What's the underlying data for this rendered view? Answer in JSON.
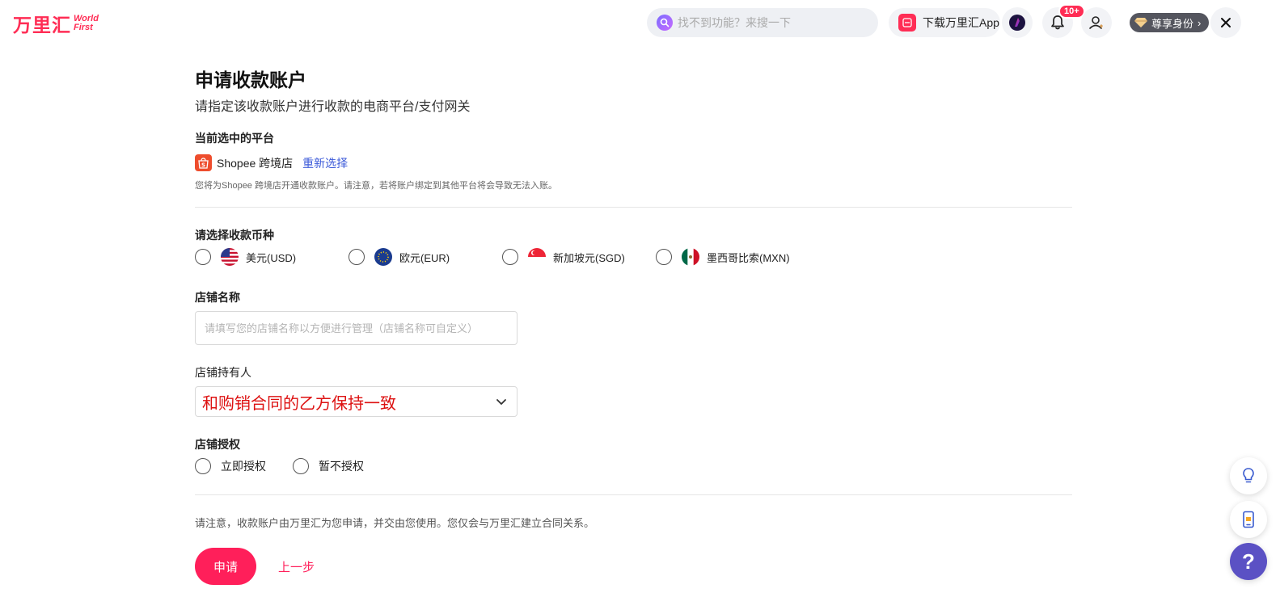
{
  "header": {
    "logo_cn": "万里汇",
    "logo_en_line1": "World",
    "logo_en_line2": "First",
    "search_placeholder": "找不到功能？来搜一下",
    "download_app_label": "下载万里汇App",
    "app_icon_text": "WorldFirst",
    "notification_count": "10+",
    "vip_label": "尊享身份",
    "vip_chevron": "›"
  },
  "page": {
    "title": "申请收款账户",
    "subtitle": "请指定该收款账户进行收款的电商平台/支付网关"
  },
  "platform": {
    "section_title": "当前选中的平台",
    "name": "Shopee 跨境店",
    "reselect_label": "重新选择",
    "note": "您将为Shopee 跨境店开通收款账户。请注意，若将账户绑定到其他平台将会导致无法入账。"
  },
  "currency": {
    "section_title": "请选择收款币种",
    "options": [
      {
        "label": "美元(USD)",
        "flag": "us-flag-icon"
      },
      {
        "label": "欧元(EUR)",
        "flag": "eu-flag-icon"
      },
      {
        "label": "新加坡元(SGD)",
        "flag": "sg-flag-icon"
      },
      {
        "label": "墨西哥比索(MXN)",
        "flag": "mx-flag-icon"
      }
    ]
  },
  "store_name": {
    "label": "店铺名称",
    "value": "",
    "placeholder": "请填写您的店铺名称以方便进行管理（店铺名称可自定义）"
  },
  "store_holder": {
    "label": "店铺持有人",
    "value": "和购销合同的乙方保持一致"
  },
  "store_auth": {
    "label": "店铺授权",
    "options": [
      "立即授权",
      "暂不授权"
    ]
  },
  "footer": {
    "note": "请注意，收款账户由万里汇为您申请，并交由您使用。您仅会与万里汇建立合同关系。",
    "submit_label": "申请",
    "back_label": "上一步"
  },
  "side_buttons": {
    "help_label": "?"
  },
  "colors": {
    "brand": "#ff2d55",
    "primary_button": "#ff1f5a",
    "link": "#3d5bd9",
    "help_button": "#5b51c4"
  }
}
